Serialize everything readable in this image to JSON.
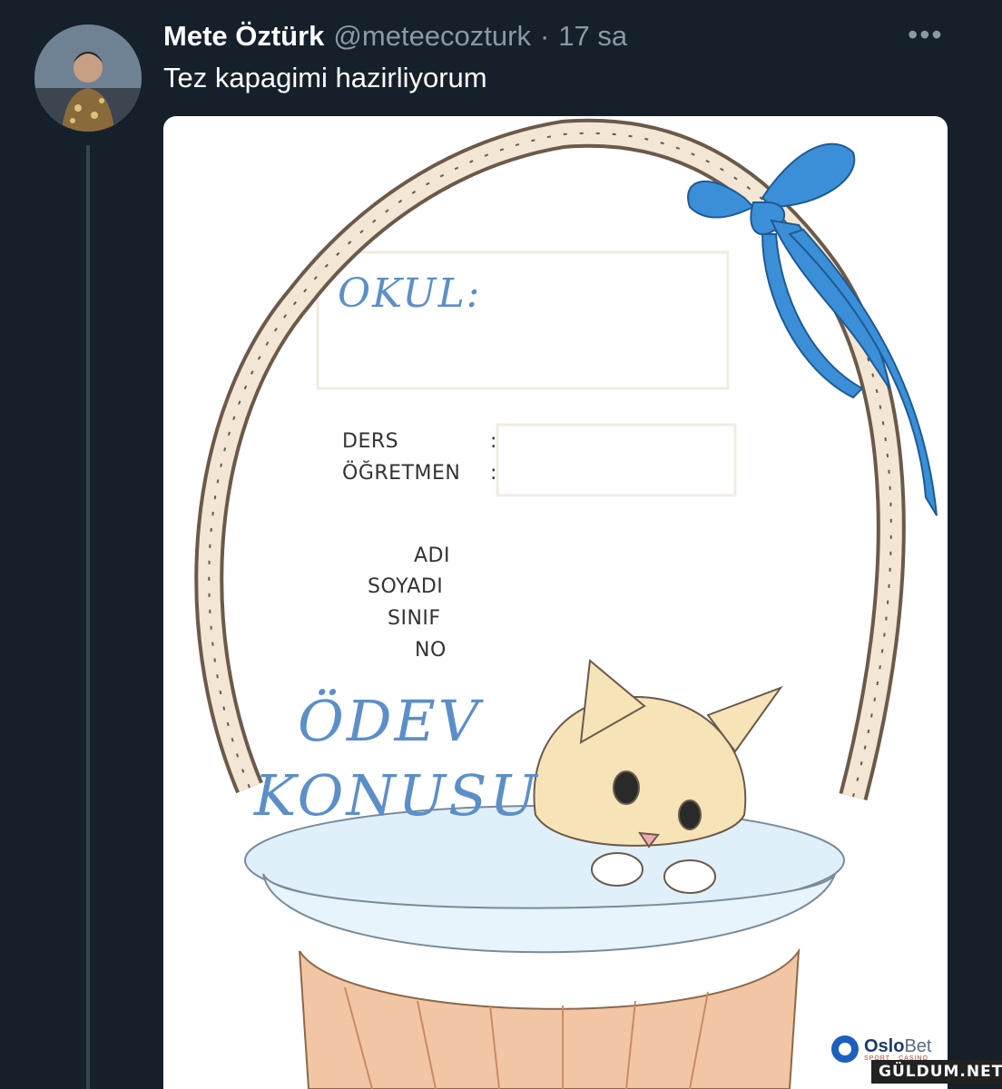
{
  "tweet": {
    "author_name": "Mete Öztürk",
    "handle": "@meteecozturk",
    "separator": "·",
    "time": "17 sa",
    "more_label": "•••",
    "text": "Tez kapagimi hazirliyorum"
  },
  "cover": {
    "okul": "OKUL:",
    "ders": "DERS",
    "ogretmen": "ÖĞRETMEN",
    "colon": ":",
    "adi": "ADI",
    "soyadi": "SOYADI",
    "sinif": "SINIF",
    "no": "NO",
    "odev": "ÖDEV",
    "konusu": "KONUSU",
    "ink_color": "#5c8fc8",
    "ribbon_color": "#3b8fd6"
  },
  "ad_logo": {
    "name_main": "Oslo",
    "name_rest": "Bet",
    "tagline": "SPORT · CASINO"
  },
  "watermark": "GÜLDUM.NET"
}
